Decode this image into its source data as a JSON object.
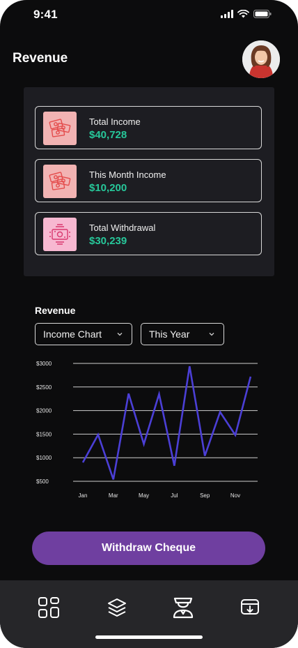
{
  "status_bar": {
    "time": "9:41"
  },
  "header": {
    "title": "Revenue"
  },
  "summary_cards": [
    {
      "label": "Total Income",
      "value": "$40,728",
      "icon": "money-bills-icon"
    },
    {
      "label": "This Month Income",
      "value": "$10,200",
      "icon": "money-bills-icon"
    },
    {
      "label": "Total Withdrawal",
      "value": "$30,239",
      "icon": "cash-withdraw-icon"
    }
  ],
  "revenue_section": {
    "title": "Revenue",
    "chart_select": {
      "value": "Income Chart"
    },
    "period_select": {
      "value": "This Year"
    }
  },
  "chart_data": {
    "type": "line",
    "y_ticks": [
      "$3000",
      "$2500",
      "$2000",
      "$1500",
      "$1000",
      "$500"
    ],
    "x_tick_labels": [
      "Jan",
      "Mar",
      "May",
      "Jul",
      "Sep",
      "Nov"
    ],
    "ylim": [
      500,
      3000
    ],
    "grid": true,
    "line_color": "#4b3fd6",
    "points": [
      {
        "x": "Jan",
        "y": 900
      },
      {
        "x": "Feb",
        "y": 1490
      },
      {
        "x": "Mar",
        "y": 540
      },
      {
        "x": "Apr",
        "y": 2360
      },
      {
        "x": "Apr-May",
        "y": 1290
      },
      {
        "x": "May",
        "y": 2350
      },
      {
        "x": "Jun",
        "y": 830
      },
      {
        "x": "Jul",
        "y": 2940
      },
      {
        "x": "Aug",
        "y": 1040
      },
      {
        "x": "Sep",
        "y": 1970
      },
      {
        "x": "Oct",
        "y": 1480
      },
      {
        "x": "Nov",
        "y": 2720
      }
    ]
  },
  "primary_action": {
    "label": "Withdraw Cheque"
  },
  "bottom_nav": [
    {
      "icon": "dashboard-grid-icon"
    },
    {
      "icon": "layers-icon"
    },
    {
      "icon": "graduate-user-icon"
    },
    {
      "icon": "download-tray-icon"
    }
  ],
  "colors": {
    "background": "#0c0c0d",
    "panel": "#1d1d22",
    "accent_value": "#27c79a",
    "button": "#6f3fa0",
    "line": "#4b3fd6"
  }
}
